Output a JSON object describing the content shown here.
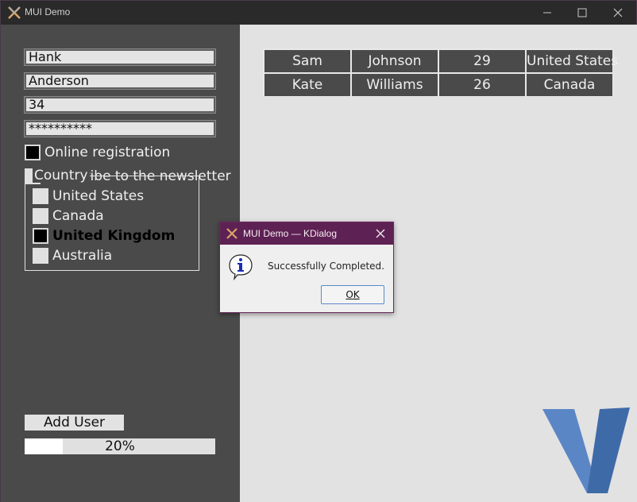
{
  "window": {
    "title": "MUI Demo",
    "icons": {
      "app": "x-logo-icon",
      "minimize": "minimize-icon",
      "maximize": "maximize-icon",
      "close": "close-icon"
    }
  },
  "form": {
    "first_name": "Hank",
    "last_name": "Anderson",
    "age": "34",
    "password": "**********",
    "online_registration": {
      "label": "Online registration",
      "checked": true
    },
    "newsletter": {
      "label": "Subscribe to the newsletter",
      "checked": false
    }
  },
  "country": {
    "legend": "Country",
    "options": [
      {
        "label": "United States",
        "selected": false
      },
      {
        "label": "Canada",
        "selected": false
      },
      {
        "label": "United Kingdom",
        "selected": true
      },
      {
        "label": "Australia",
        "selected": false
      }
    ]
  },
  "actions": {
    "add_user_label": "Add User"
  },
  "progress": {
    "value": 20,
    "label": "20%"
  },
  "users_table": {
    "rows": [
      [
        "Sam",
        "Johnson",
        "29",
        "United States"
      ],
      [
        "Kate",
        "Williams",
        "26",
        "Canada"
      ]
    ]
  },
  "dialog": {
    "title": "MUI Demo — KDialog",
    "message": "Successfully Completed.",
    "ok_label": "OK",
    "icons": {
      "app": "x-logo-icon",
      "info": "info-icon",
      "close": "close-icon"
    }
  },
  "logo": {
    "icon": "v-logo-icon",
    "colors": {
      "light": "#5b86c6",
      "dark": "#3f6aa8"
    }
  },
  "colors": {
    "left_panel": "#4a4a4a",
    "right_panel": "#e2e2e2",
    "dialog_title": "#5e2153"
  }
}
